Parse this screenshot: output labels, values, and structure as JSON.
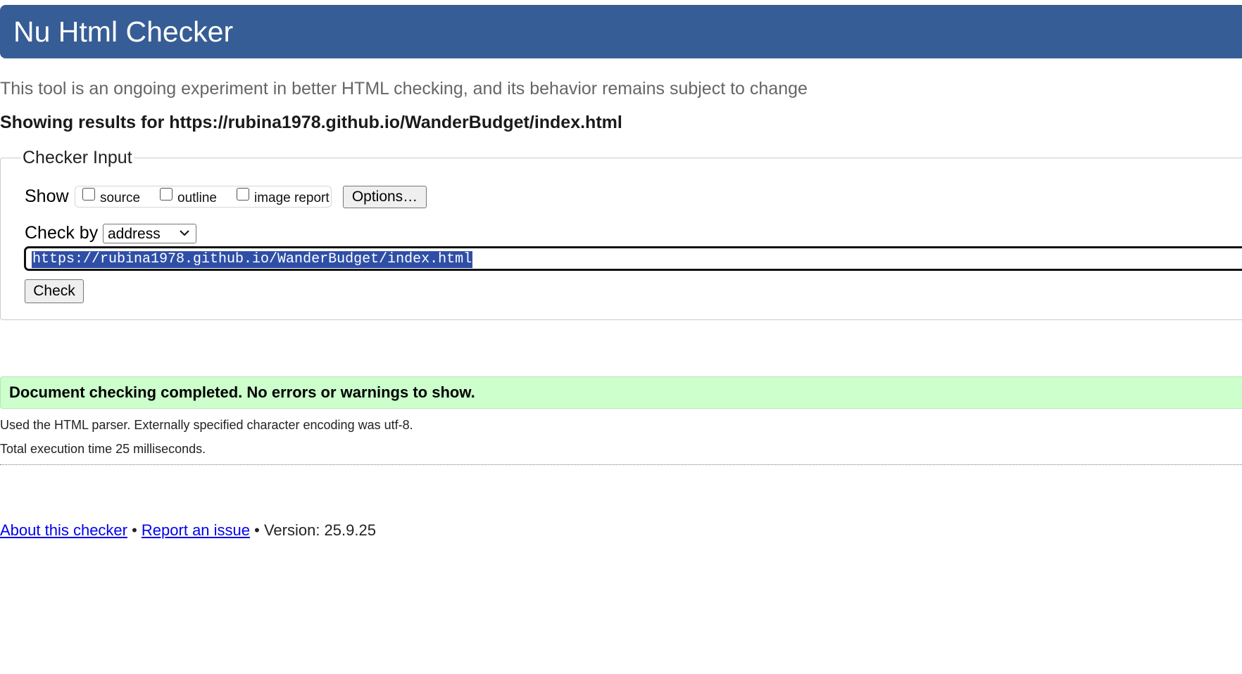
{
  "header": {
    "title": "Nu Html Checker"
  },
  "intro": {
    "subtitle": "This tool is an ongoing experiment in better HTML checking, and its behavior remains subject to change",
    "results_for": "Showing results for https://rubina1978.github.io/WanderBudget/index.html"
  },
  "checker_input": {
    "legend": "Checker Input",
    "show_label": "Show",
    "options": [
      {
        "label": "source",
        "checked": false
      },
      {
        "label": "outline",
        "checked": false
      },
      {
        "label": "image report",
        "checked": false
      }
    ],
    "options_button": "Options…",
    "check_by_label": "Check by",
    "check_by_value": "address",
    "url_value": "https://rubina1978.github.io/WanderBudget/index.html",
    "check_button": "Check"
  },
  "results": {
    "success_message": "Document checking completed. No errors or warnings to show.",
    "parser_info": "Used the HTML parser. Externally specified character encoding was utf-8.",
    "execution_time": "Total execution time 25 milliseconds."
  },
  "footer": {
    "about_link": "About this checker",
    "separator": " • ",
    "report_link": "Report an issue",
    "version_text": "Version: 25.9.25"
  },
  "colors": {
    "header_bg": "#365d95",
    "success_bg": "#ccffcc",
    "selection_bg": "#2f4fa7",
    "link": "#0000ee"
  }
}
